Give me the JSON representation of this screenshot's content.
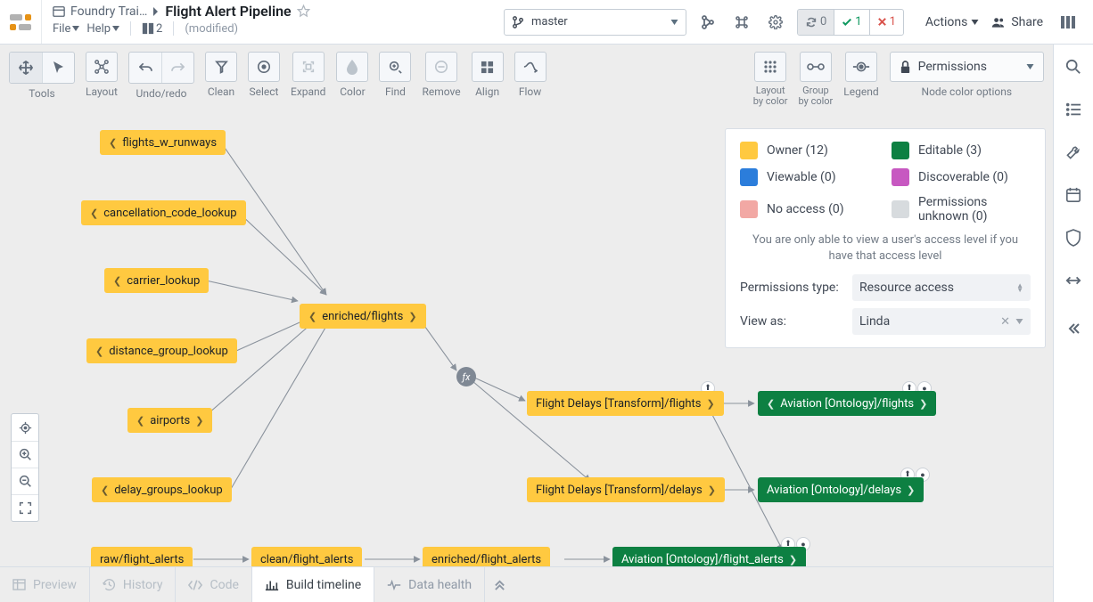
{
  "header": {
    "breadcrumb_parent": "Foundry Trai…",
    "title": "Flight Alert Pipeline",
    "menu_file": "File",
    "menu_help": "Help",
    "panel_count": "2",
    "modified_label": "(modified)",
    "branch": "master",
    "sync_count": "0",
    "ok_count": "1",
    "err_count": "1",
    "actions_label": "Actions",
    "share_label": "Share"
  },
  "toolbar": {
    "tools": "Tools",
    "layout": "Layout",
    "undoredo": "Undo/redo",
    "clean": "Clean",
    "select": "Select",
    "expand": "Expand",
    "color": "Color",
    "find": "Find",
    "remove": "Remove",
    "align": "Align",
    "flow": "Flow",
    "layout_by_color": "Layout by color",
    "group_by_color": "Group by color",
    "legend": "Legend",
    "permissions_btn": "Permissions",
    "node_color_options": "Node color options"
  },
  "legend": {
    "owner": "Owner (12)",
    "editable": "Editable (3)",
    "viewable": "Viewable (0)",
    "discoverable": "Discoverable (0)",
    "no_access": "No access (0)",
    "unknown": "Permissions unknown (0)",
    "hint": "You are only able to view a user's access level if you have that access level",
    "perm_type_label": "Permissions type:",
    "perm_type_value": "Resource access",
    "view_as_label": "View as:",
    "view_as_value": "Linda",
    "colors": {
      "owner": "#ffc940",
      "editable": "#0d8042",
      "viewable": "#2b7ddb",
      "discoverable": "#c758c1",
      "no_access": "#f2a8a4",
      "unknown": "#d7dbde"
    }
  },
  "nodes": {
    "flights_w_runways": "flights_w_runways",
    "cancellation_code_lookup": "cancellation_code_lookup",
    "carrier_lookup": "carrier_lookup",
    "enriched_flights": "enriched/flights",
    "distance_group_lookup": "distance_group_lookup",
    "airports": "airports",
    "delay_groups_lookup": "delay_groups_lookup",
    "flight_delays_transform_flights": "Flight Delays [Transform]/flights",
    "aviation_ontology_flights": "Aviation [Ontology]/flights",
    "flight_delays_transform_delays": "Flight Delays [Transform]/delays",
    "aviation_ontology_delays": "Aviation [Ontology]/delays",
    "raw_flight_alerts": "raw/flight_alerts",
    "clean_flight_alerts": "clean/flight_alerts",
    "enriched_flight_alerts": "enriched/flight_alerts",
    "aviation_ontology_flight_alerts": "Aviation [Ontology]/flight_alerts"
  },
  "bottom": {
    "preview": "Preview",
    "history": "History",
    "code": "Code",
    "build_timeline": "Build timeline",
    "data_health": "Data health"
  }
}
